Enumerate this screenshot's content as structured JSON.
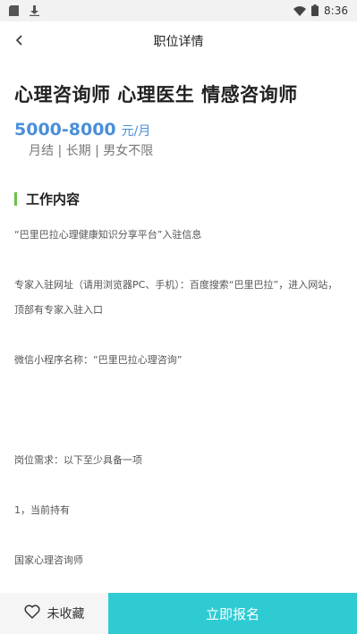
{
  "status_bar": {
    "time": "8:36",
    "icons": [
      "sd-card-icon",
      "download-icon",
      "wifi-icon",
      "battery-icon"
    ]
  },
  "nav": {
    "title": "职位详情",
    "back_icon": "chevron-left-icon"
  },
  "job": {
    "title": "心理咨询师 心理医生 情感咨询师",
    "salary": "5000-8000",
    "salary_unit": "元/月",
    "tags": "月结 | 长期 | 男女不限"
  },
  "section": {
    "title": "工作内容",
    "accent_color": "#6cc04a"
  },
  "description": [
    "“巴里巴拉心理健康知识分享平台”入驻信息",
    "",
    "专家入驻网址（请用浏览器PC、手机）：百度搜索“巴里巴拉”，进入网站，顶部有专家入驻入口",
    "",
    "微信小程序名称：“巴里巴拉心理咨询”",
    "",
    "",
    "",
    "岗位需求：以下至少具备一项",
    "",
    "1，当前持有",
    "",
    "国家心理咨询师"
  ],
  "bottom": {
    "favorite_label": "未收藏",
    "favorite_icon": "heart-outline-icon",
    "apply_label": "立即报名",
    "apply_color": "#2ecbd3"
  }
}
